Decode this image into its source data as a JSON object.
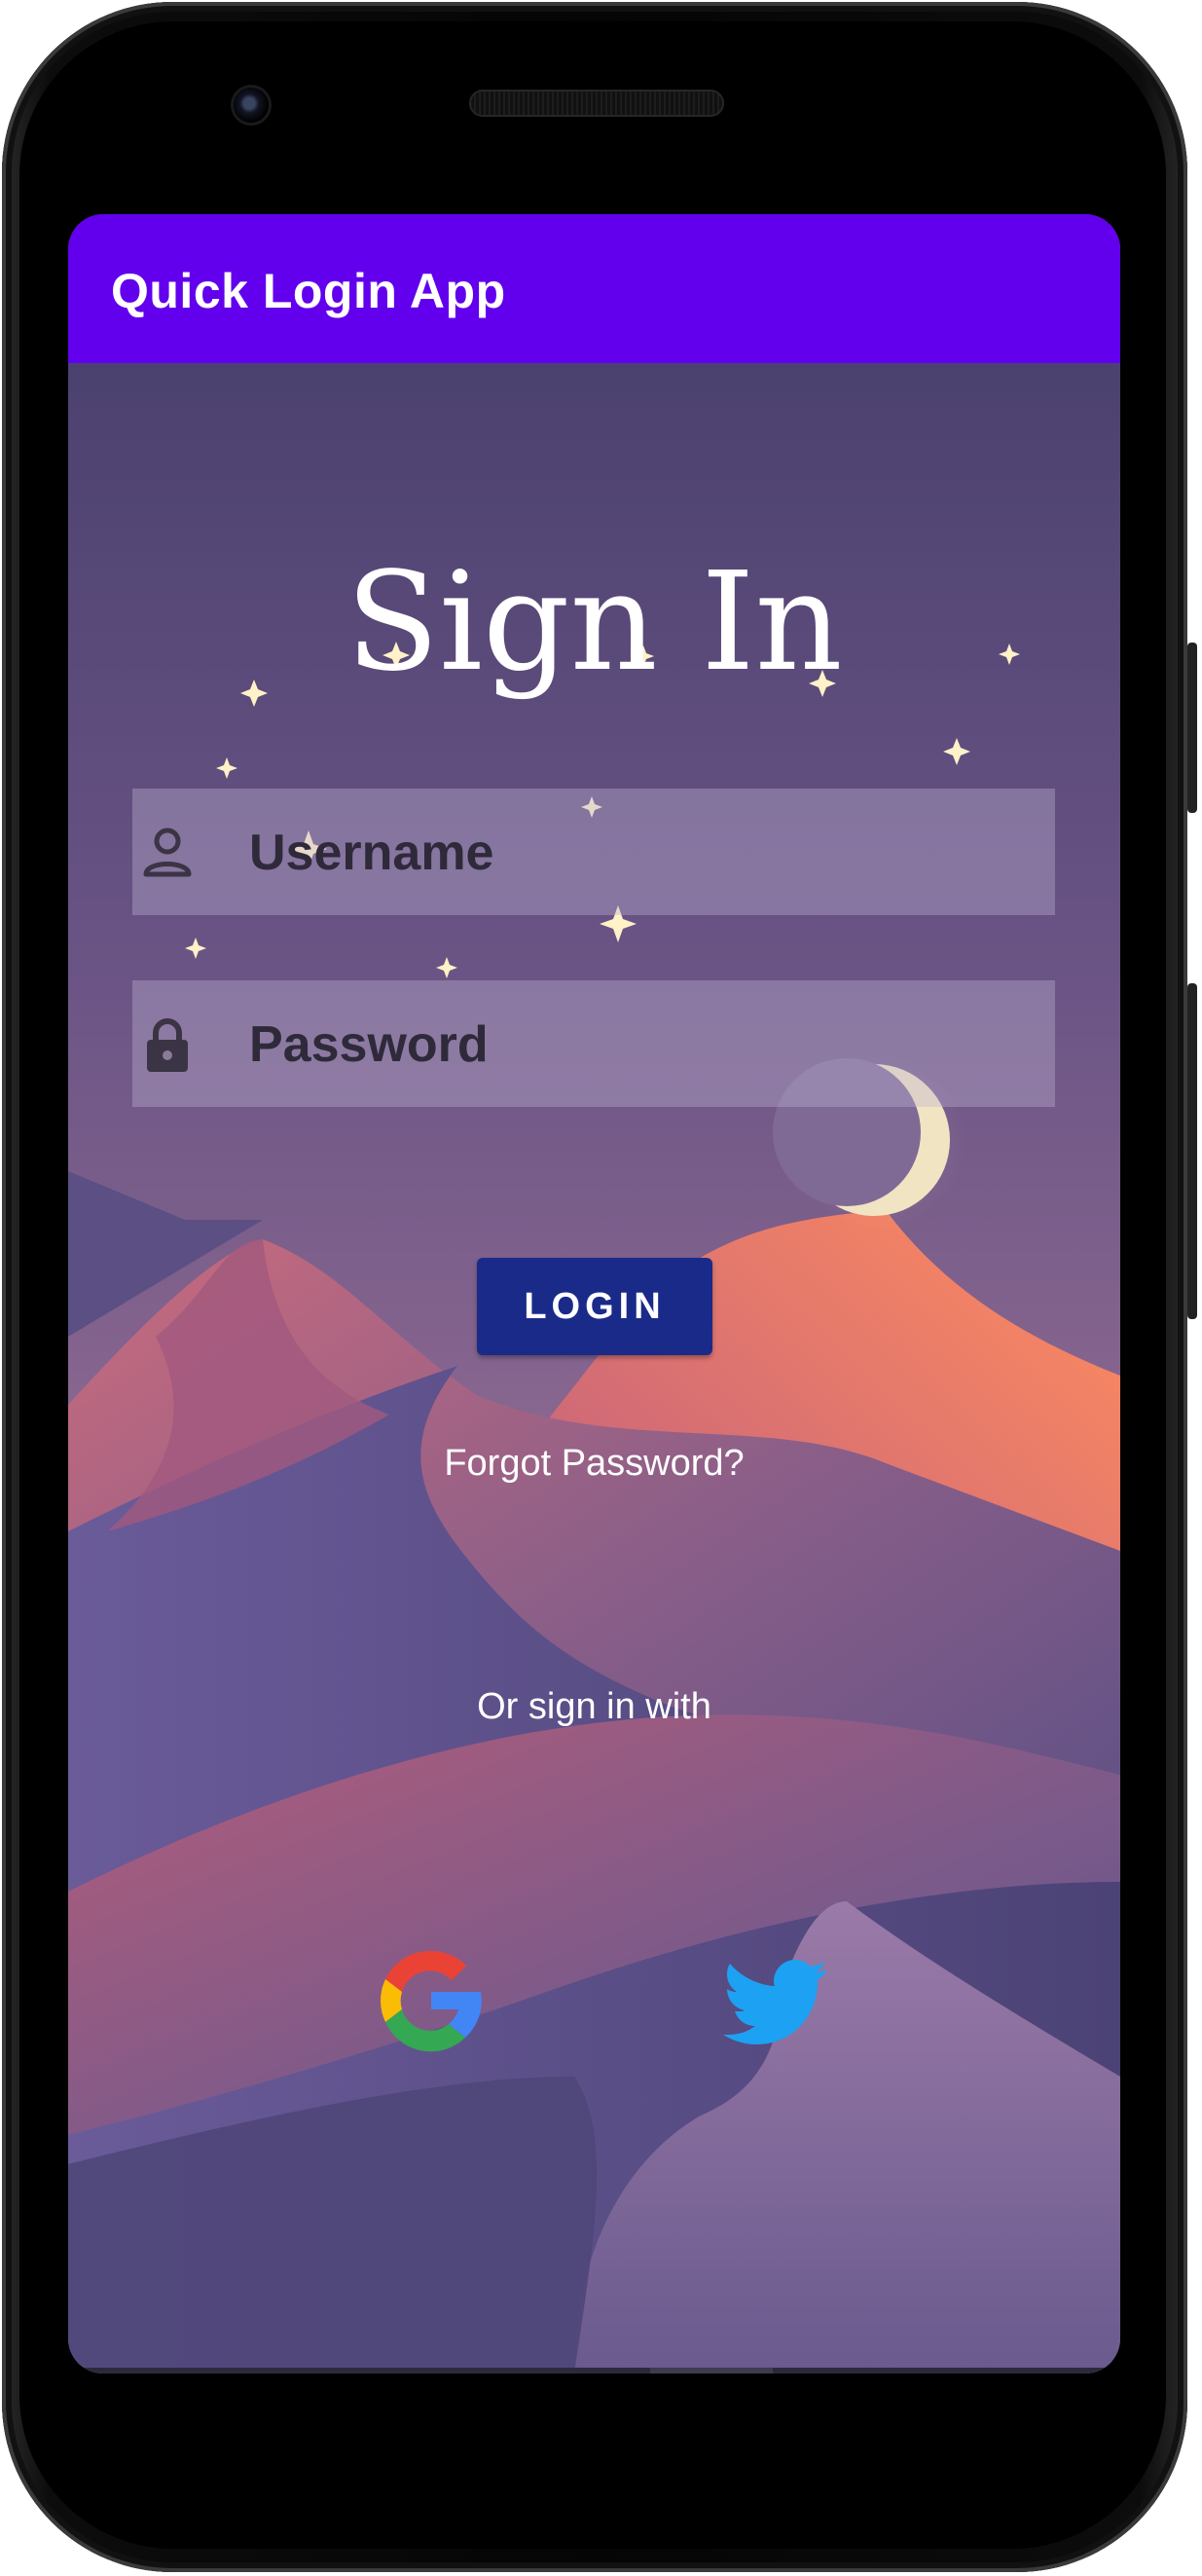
{
  "app": {
    "title": "Quick Login App"
  },
  "screen": {
    "heading": "Sign In"
  },
  "form": {
    "username": {
      "placeholder": "Username",
      "icon": "person-icon"
    },
    "password": {
      "placeholder": "Password",
      "icon": "lock-icon"
    },
    "login_label": "LOGIN",
    "forgot_label": "Forgot Password?",
    "or_label": "Or sign in with"
  },
  "social": [
    {
      "name": "Google",
      "icon": "google-icon"
    },
    {
      "name": "Twitter",
      "icon": "twitter-icon"
    }
  ],
  "colors": {
    "app_bar": "#6200EE",
    "login_button": "#1A2A88",
    "sky_top": "#4B416F",
    "sky_bottom": "#8B6890",
    "moon": "#F1E4C2",
    "twitter": "#1DA1F2"
  }
}
